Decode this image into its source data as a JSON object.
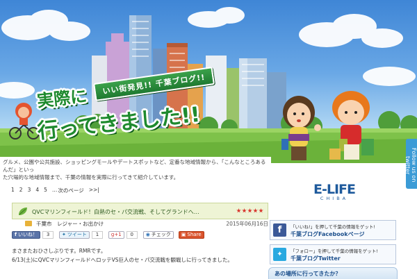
{
  "hero": {
    "subtitle": "いい街発見!! 千葉ブログ!!",
    "title_line1": "実際に",
    "title_line2": "行ってきました!!",
    "side_tab": "Follow us on twitter"
  },
  "intro": {
    "line1": "グルメ、公園や公共施設、ショッピングモールやデートスポットなど、定番な地域情報から、「こんなところあるんだ」といっ",
    "line2": "た穴場的な地域情報まで、千葉の情報を実際に行ってきて紹介しています。"
  },
  "pagination": {
    "pages": [
      "1",
      "2",
      "3",
      "4",
      "5"
    ],
    "ellipsis": "…",
    "next": "次のページ",
    "last": ">>|"
  },
  "post": {
    "title": "QVCマリンフィールド！白熱のセ・パ交流戦、そしてグランドへ…",
    "rating": 5,
    "category1": "千葉市",
    "category2": "レジャー・お出かけ",
    "date": "2015年06月16日",
    "body1": "まさまたおひさしぶりです。RMRです。",
    "body2": "6/13(土)にQVCマリンフィールドへロッテVS巨人のセ・パ交流戦を観戦しに行ってきました。"
  },
  "social": {
    "like_label": "いいね！",
    "like_count": "3",
    "tweet_label": "ツイート",
    "tweet_count": "1",
    "gplus_label": "g+1",
    "gplus_count": "0",
    "check_label": "チェック",
    "share_label": "Share"
  },
  "sidebar": {
    "logo_main": "E-LIFE",
    "logo_sub": "CHIBA",
    "fb_small": "「いいね!」を押して千葉の情報をゲット!",
    "fb_big": "千葉ブログFacebookページ",
    "tw_small": "「フォロー」を押して千葉の情報をゲット!",
    "tw_big": "千葉ブログTwitter",
    "bottom_title": "あの場所に行ってきたか？"
  },
  "colors": {
    "title_green": "#1e8a2e",
    "facebook_blue": "#3b5998",
    "twitter_blue": "#2aa9e0",
    "star_red": "#d8322a"
  }
}
